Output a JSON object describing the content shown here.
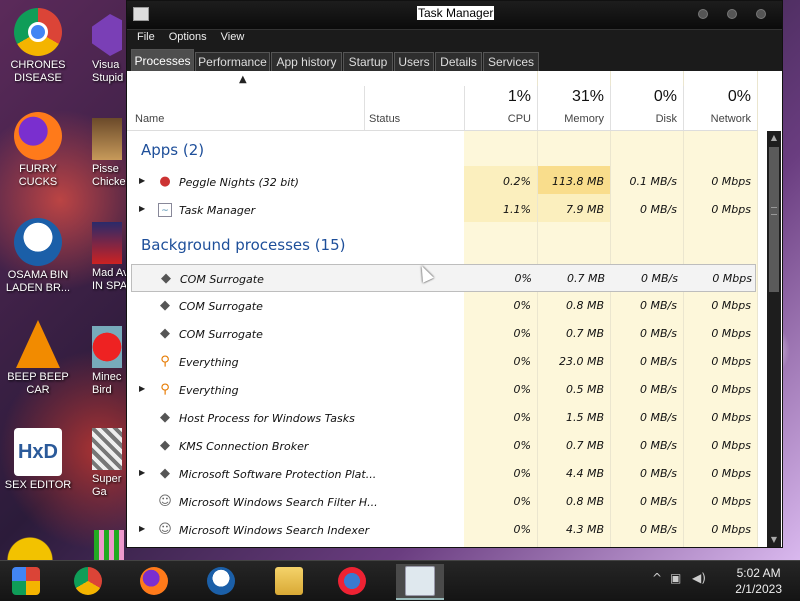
{
  "desktop_icons": [
    {
      "label": "CHRONES DISEASE",
      "icon": "chrome-icon"
    },
    {
      "label": "FURRY CUCKS",
      "icon": "firefox-icon"
    },
    {
      "label": "OSAMA BIN LADEN BR...",
      "icon": "obama-logo-icon"
    },
    {
      "label": "BEEP BEEP CAR",
      "icon": "vlc-cone-icon"
    },
    {
      "label": "SEX EDITOR",
      "icon": "hxd-icon"
    }
  ],
  "desktop_icons_col2": [
    {
      "label": "Visua Stupid",
      "icon": "visual-studio-icon"
    },
    {
      "label": "Pisse Chicke",
      "icon": "game-icon"
    },
    {
      "label": "Mad Av IN SPA",
      "icon": "angry-birds-space-icon"
    },
    {
      "label": "Minec Bird",
      "icon": "angry-birds-icon"
    },
    {
      "label": "Super Ga",
      "icon": "game-icon"
    }
  ],
  "window": {
    "title": "Task Manager",
    "menu": [
      "File",
      "Options",
      "View"
    ],
    "tabs": [
      "Processes",
      "Performance",
      "App history",
      "Startup",
      "Users",
      "Details",
      "Services"
    ],
    "active_tab": "Processes"
  },
  "columns": {
    "name": "Name",
    "status": "Status",
    "cpu": {
      "pct": "1%",
      "label": "CPU"
    },
    "memory": {
      "pct": "31%",
      "label": "Memory"
    },
    "disk": {
      "pct": "0%",
      "label": "Disk"
    },
    "network": {
      "pct": "0%",
      "label": "Network"
    }
  },
  "groups": {
    "apps": "Apps (2)",
    "background": "Background processes (15)"
  },
  "apps": [
    {
      "name": "Peggle Nights (32 bit)",
      "icon": "peggle-icon",
      "expandable": true,
      "cpu": "0.2%",
      "memory": "113.8 MB",
      "disk": "0.1 MB/s",
      "network": "0 Mbps"
    },
    {
      "name": "Task Manager",
      "icon": "task-manager-icon",
      "expandable": true,
      "cpu": "1.1%",
      "memory": "7.9 MB",
      "disk": "0 MB/s",
      "network": "0 Mbps"
    }
  ],
  "background": [
    {
      "name": "COM Surrogate",
      "icon": "diamond-icon",
      "expandable": false,
      "cpu": "0%",
      "memory": "0.7 MB",
      "disk": "0 MB/s",
      "network": "0 Mbps",
      "selected": true
    },
    {
      "name": "COM Surrogate",
      "icon": "diamond-icon",
      "expandable": false,
      "cpu": "0%",
      "memory": "0.8 MB",
      "disk": "0 MB/s",
      "network": "0 Mbps"
    },
    {
      "name": "COM Surrogate",
      "icon": "diamond-icon",
      "expandable": false,
      "cpu": "0%",
      "memory": "0.7 MB",
      "disk": "0 MB/s",
      "network": "0 Mbps"
    },
    {
      "name": "Everything",
      "icon": "magnifier-icon",
      "expandable": false,
      "cpu": "0%",
      "memory": "23.0 MB",
      "disk": "0 MB/s",
      "network": "0 Mbps"
    },
    {
      "name": "Everything",
      "icon": "magnifier-icon",
      "expandable": true,
      "cpu": "0%",
      "memory": "0.5 MB",
      "disk": "0 MB/s",
      "network": "0 Mbps"
    },
    {
      "name": "Host Process for Windows Tasks",
      "icon": "diamond-icon",
      "expandable": false,
      "cpu": "0%",
      "memory": "1.5 MB",
      "disk": "0 MB/s",
      "network": "0 Mbps"
    },
    {
      "name": "KMS Connection Broker",
      "icon": "diamond-icon",
      "expandable": false,
      "cpu": "0%",
      "memory": "0.7 MB",
      "disk": "0 MB/s",
      "network": "0 Mbps"
    },
    {
      "name": "Microsoft Software Protection Plat...",
      "icon": "diamond-icon",
      "expandable": true,
      "cpu": "0%",
      "memory": "4.4 MB",
      "disk": "0 MB/s",
      "network": "0 Mbps"
    },
    {
      "name": "Microsoft Windows Search Filter H...",
      "icon": "search-person-icon",
      "expandable": false,
      "cpu": "0%",
      "memory": "0.8 MB",
      "disk": "0 MB/s",
      "network": "0 Mbps"
    },
    {
      "name": "Microsoft Windows Search Indexer",
      "icon": "search-person-icon",
      "expandable": true,
      "cpu": "0%",
      "memory": "4.3 MB",
      "disk": "0 MB/s",
      "network": "0 Mbps"
    }
  ],
  "taskbar": {
    "items": [
      "start-icon",
      "chrome-icon",
      "firefox-icon",
      "obama-logo-icon",
      "file-explorer-icon",
      "peggle-icon",
      "task-manager-icon"
    ],
    "active": "task-manager-icon",
    "time": "5:02 AM",
    "date": "2/1/2023"
  }
}
